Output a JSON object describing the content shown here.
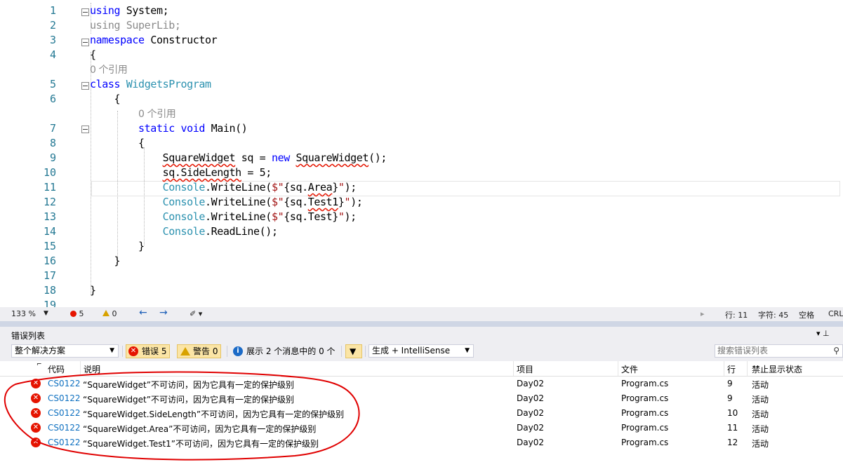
{
  "editor": {
    "lines": [
      {
        "n": "1",
        "html": "<span class='kw'>using</span> System;"
      },
      {
        "n": "2",
        "html": "<span class='dim'>using SuperLib;</span>"
      },
      {
        "n": "3",
        "html": "<span class='kw'>namespace</span> Constructor"
      },
      {
        "n": "4",
        "html": "{"
      },
      {
        "n": "",
        "html": "<span class='ref'>0 个引用</span>"
      },
      {
        "n": "5",
        "html": "<span class='kw'>class</span> <span class='ty'>WidgetsProgram</span>"
      },
      {
        "n": "6",
        "html": "    {"
      },
      {
        "n": "",
        "html": "        <span class='ref'>0 个引用</span>"
      },
      {
        "n": "7",
        "html": "        <span class='kw'>static</span> <span class='kw'>void</span> Main()"
      },
      {
        "n": "8",
        "html": "        {"
      },
      {
        "n": "9",
        "html": "            <span class='squig'>SquareWidget</span> sq = <span class='kw'>new</span> <span class='squig'>SquareWidget</span>();"
      },
      {
        "n": "10",
        "html": "            <span class='squig'>sq.SideLength</span> = 5;"
      },
      {
        "n": "11",
        "html": "            <span class='ty'>Console</span>.WriteLine(<span class='st'>$\"</span>{sq.<span class='squig'>Area</span>}<span class='st'>\"</span>);"
      },
      {
        "n": "12",
        "html": "            <span class='ty'>Console</span>.WriteLine(<span class='st'>$\"</span>{sq.<span class='squig'>Test1</span>}<span class='st'>\"</span>);"
      },
      {
        "n": "13",
        "html": "            <span class='ty'>Console</span>.WriteLine(<span class='st'>$\"</span>{sq.Test}<span class='st'>\"</span>);"
      },
      {
        "n": "14",
        "html": "            <span class='ty'>Console</span>.ReadLine();"
      },
      {
        "n": "15",
        "html": "        }"
      },
      {
        "n": "16",
        "html": "    }"
      },
      {
        "n": "17",
        "html": ""
      },
      {
        "n": "18",
        "html": "}"
      },
      {
        "n": "19",
        "html": ""
      }
    ]
  },
  "status": {
    "zoom": "133 %",
    "errors": "5",
    "warnings": "0",
    "line": "行: 11",
    "col": "字符: 45",
    "space": "空格",
    "eol": "CRL"
  },
  "panel": {
    "title": "错误列表",
    "pin": "▾ ⊥",
    "scope": "整个解决方案",
    "errors_btn": "错误 5",
    "warnings_btn": "警告 0",
    "messages_btn": "展示 2 个消息中的 0 个",
    "build_filter": "生成 + IntelliSense",
    "search_placeholder": "搜索错误列表"
  },
  "grid": {
    "headers": {
      "code": "代码",
      "desc": "说明",
      "project": "项目",
      "file": "文件",
      "line": "行",
      "suppress": "禁止显示状态"
    },
    "rows": [
      {
        "code": "CS0122",
        "desc": "“SquareWidget”不可访问，因为它具有一定的保护级别",
        "project": "Day02",
        "file": "Program.cs",
        "line": "9",
        "state": "活动"
      },
      {
        "code": "CS0122",
        "desc": "“SquareWidget”不可访问，因为它具有一定的保护级别",
        "project": "Day02",
        "file": "Program.cs",
        "line": "9",
        "state": "活动"
      },
      {
        "code": "CS0122",
        "desc": "“SquareWidget.SideLength”不可访问，因为它具有一定的保护级别",
        "project": "Day02",
        "file": "Program.cs",
        "line": "10",
        "state": "活动"
      },
      {
        "code": "CS0122",
        "desc": "“SquareWidget.Area”不可访问，因为它具有一定的保护级别",
        "project": "Day02",
        "file": "Program.cs",
        "line": "11",
        "state": "活动"
      },
      {
        "code": "CS0122",
        "desc": "“SquareWidget.Test1”不可访问，因为它具有一定的保护级别",
        "project": "Day02",
        "file": "Program.cs",
        "line": "12",
        "state": "活动"
      }
    ]
  },
  "colors": {
    "error": "#e51400",
    "keyword": "#0000ff",
    "type": "#2b91af",
    "annotation": "#e00000"
  }
}
